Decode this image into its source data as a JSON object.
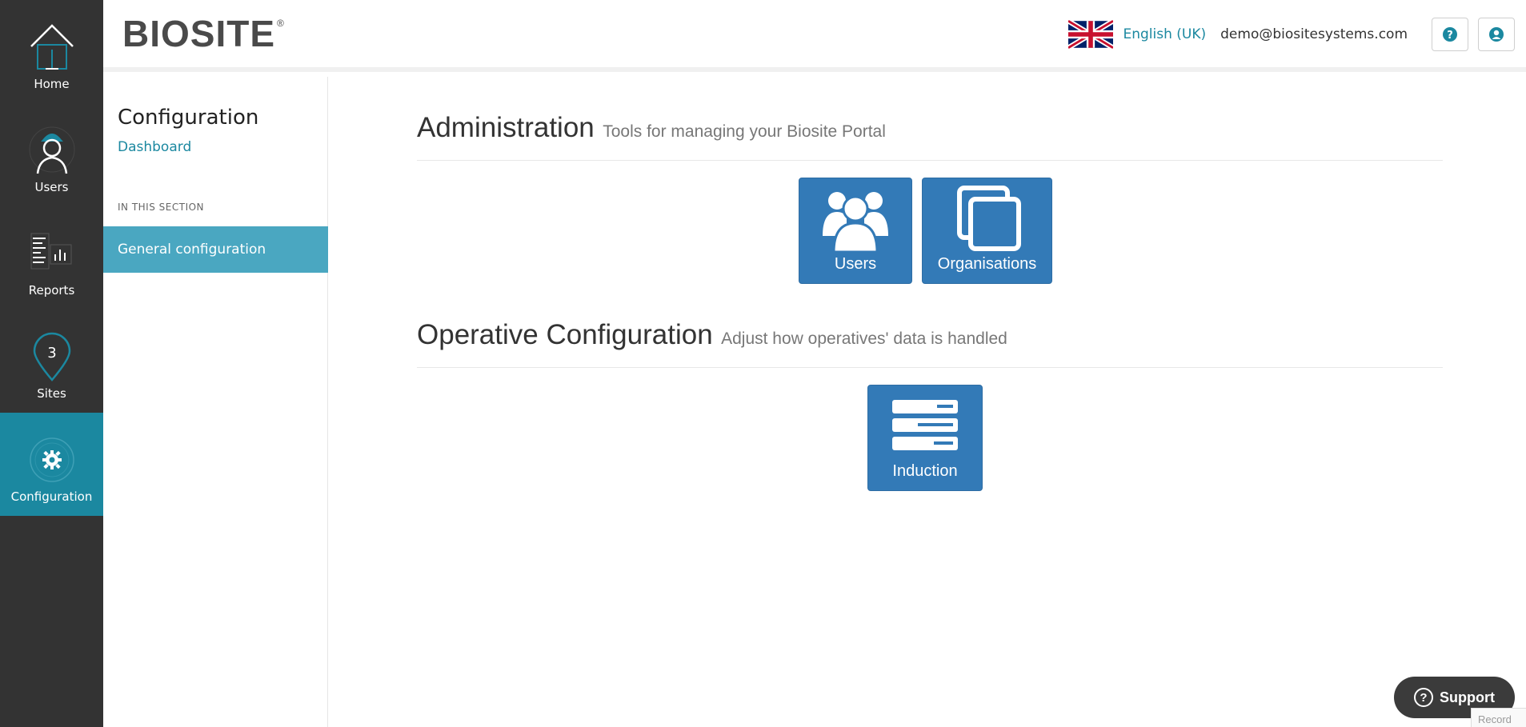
{
  "rail": {
    "items": [
      {
        "label": "Home",
        "icon": "house-icon"
      },
      {
        "label": "Users",
        "icon": "worker-icon"
      },
      {
        "label": "Reports",
        "icon": "report-icon"
      },
      {
        "label": "Sites",
        "icon": "map-pin-icon"
      },
      {
        "label": "Configuration",
        "icon": "gear-icon"
      }
    ],
    "active_index": 4
  },
  "header": {
    "logo_text": "BIOSITE",
    "logo_mark": "®",
    "language": "English (UK)",
    "email": "demo@biositesystems.com"
  },
  "side": {
    "title": "Configuration",
    "link": "Dashboard",
    "section_label": "IN THIS SECTION",
    "items": [
      {
        "label": "General configuration"
      }
    ]
  },
  "main": {
    "sections": [
      {
        "title": "Administration",
        "subtitle": "Tools for managing your Biosite Portal",
        "tiles": [
          {
            "label": "Users",
            "icon": "users-group-icon"
          },
          {
            "label": "Organisations",
            "icon": "copy-icon"
          }
        ]
      },
      {
        "title": "Operative Configuration",
        "subtitle": "Adjust how operatives' data is handled",
        "tiles": [
          {
            "label": "Induction",
            "icon": "server-list-icon"
          }
        ]
      }
    ]
  },
  "support": {
    "label": "Support"
  },
  "recaptcha": {
    "label": "Record"
  },
  "colors": {
    "rail_bg": "#333333",
    "rail_active": "#1b88a0",
    "tile_bg": "#337ab7",
    "side_active": "#4aa7c1",
    "link": "#1b88a0"
  }
}
